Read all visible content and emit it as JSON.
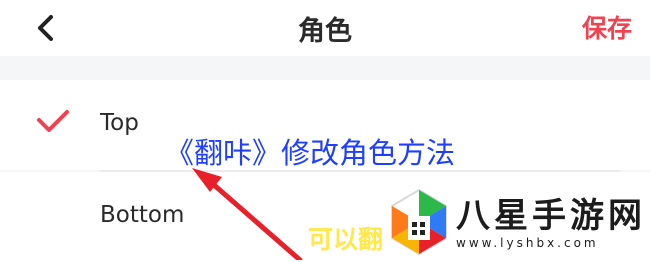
{
  "header": {
    "back_icon": "chevron-left-icon",
    "title": "角色",
    "save_label": "保存",
    "save_color": "#f0424f"
  },
  "options": [
    {
      "label": "Top",
      "selected": true
    },
    {
      "label": "Bottom",
      "selected": false
    }
  ],
  "overlay": {
    "caption": "《翻咔》修改角色方法",
    "caption_color": "#1f3fff",
    "subtext": "可以翻",
    "subtext_color": "#ffe84a",
    "arrow_color": "#e8202a"
  },
  "watermark": {
    "title": "八星手游网",
    "url": "www.lyshbx.com"
  }
}
